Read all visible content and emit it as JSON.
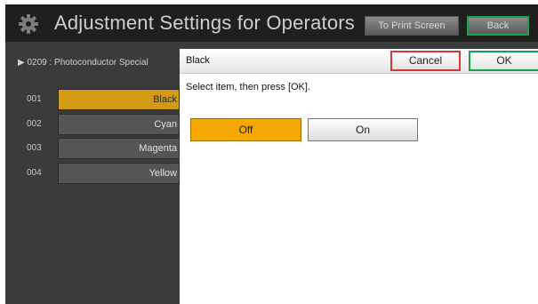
{
  "header": {
    "title": "Adjustment Settings for Operators",
    "to_print_screen_label": "To Print Screen",
    "back_label": "Back",
    "icon": "gear-icon"
  },
  "left_panel": {
    "breadcrumb": "▶ 0209  : Photoconductor Special",
    "items": [
      {
        "number": "001",
        "label": "Black",
        "selected": true
      },
      {
        "number": "002",
        "label": "Cyan",
        "selected": false
      },
      {
        "number": "003",
        "label": "Magenta",
        "selected": false
      },
      {
        "number": "004",
        "label": "Yellow",
        "selected": false
      }
    ]
  },
  "dialog": {
    "title": "Black",
    "cancel_label": "Cancel",
    "ok_label": "OK",
    "instruction": "Select item, then press [OK].",
    "options": [
      {
        "label": "Off",
        "selected": true
      },
      {
        "label": "On",
        "selected": false
      }
    ]
  },
  "colors": {
    "selected_accent": "#f5a800",
    "ok_border": "#1aa14c",
    "cancel_border": "#d03a3a",
    "back_border": "#18a24a"
  }
}
